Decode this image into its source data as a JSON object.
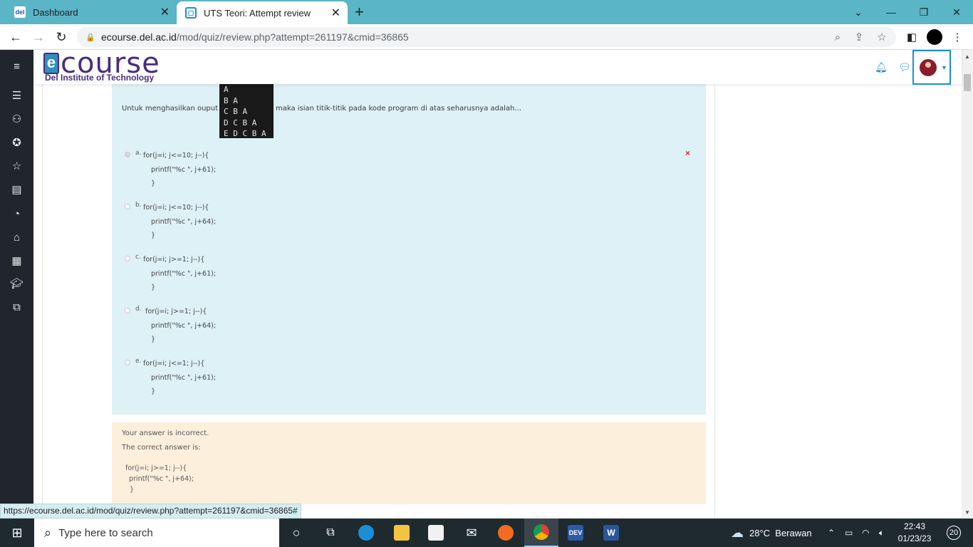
{
  "browser": {
    "tabs": [
      {
        "title": "Dashboard",
        "favicon": "del-logo-icon",
        "active": false
      },
      {
        "title": "UTS Teori: Attempt review",
        "favicon": "moodle-icon",
        "active": true
      }
    ],
    "url_host": "ecourse.del.ac.id",
    "url_path": "/mod/quiz/review.php?attempt=261197&cmid=36865",
    "status_url": "https://ecourse.del.ac.id/mod/quiz/review.php?attempt=261197&cmid=36865#"
  },
  "site": {
    "logo_text": "course",
    "logo_letter": "e",
    "logo_subtitle": "Del Institute of Technology",
    "brand_color": "#4b2c7d",
    "accent_color": "#1a8fd6"
  },
  "question": {
    "text_before": "Untuk menghasilkan ouput",
    "text_after": "maka isian titik-titik pada kode program di atas seharusnya adalah...",
    "output_lines": [
      "A",
      "B A",
      "C B A",
      "D C B A",
      "E D C B A"
    ],
    "result_mark": "×",
    "options": [
      {
        "letter": "a.",
        "line1": "for(j=i; j<=10; j--){",
        "line2": "printf(\"%c \", j+61);",
        "line3": "}",
        "selected": true
      },
      {
        "letter": "b.",
        "line1": "for(j=i; j<=10; j--){",
        "line2": "printf(\"%c \", j+64);",
        "line3": "}",
        "selected": false
      },
      {
        "letter": "c.",
        "line1": "for(j=i; j>=1; j--){",
        "line2": "printf(\"%c \", j+61);",
        "line3": "}",
        "selected": false
      },
      {
        "letter": "d.",
        "line1": " for(j=i; j>=1; j--){",
        "line2": "printf(\"%c \", j+64);",
        "line3": "}",
        "selected": false
      },
      {
        "letter": "e.",
        "line1": "for(j=i; j<=1; j--){",
        "line2": "printf(\"%c \", j+61);",
        "line3": "}",
        "selected": false
      }
    ]
  },
  "feedback": {
    "incorrect": "Your answer is incorrect.",
    "correct_label": "The correct answer is:",
    "code_line1": "for(j=i; j>=1; j--){",
    "code_line2": "printf(\"%c \", j+64);",
    "code_line3": "}"
  },
  "taskbar": {
    "search_placeholder": "Type here to search",
    "weather": "28°C  Berawan",
    "time": "22:43",
    "date": "01/23/23",
    "notifications": "20"
  }
}
